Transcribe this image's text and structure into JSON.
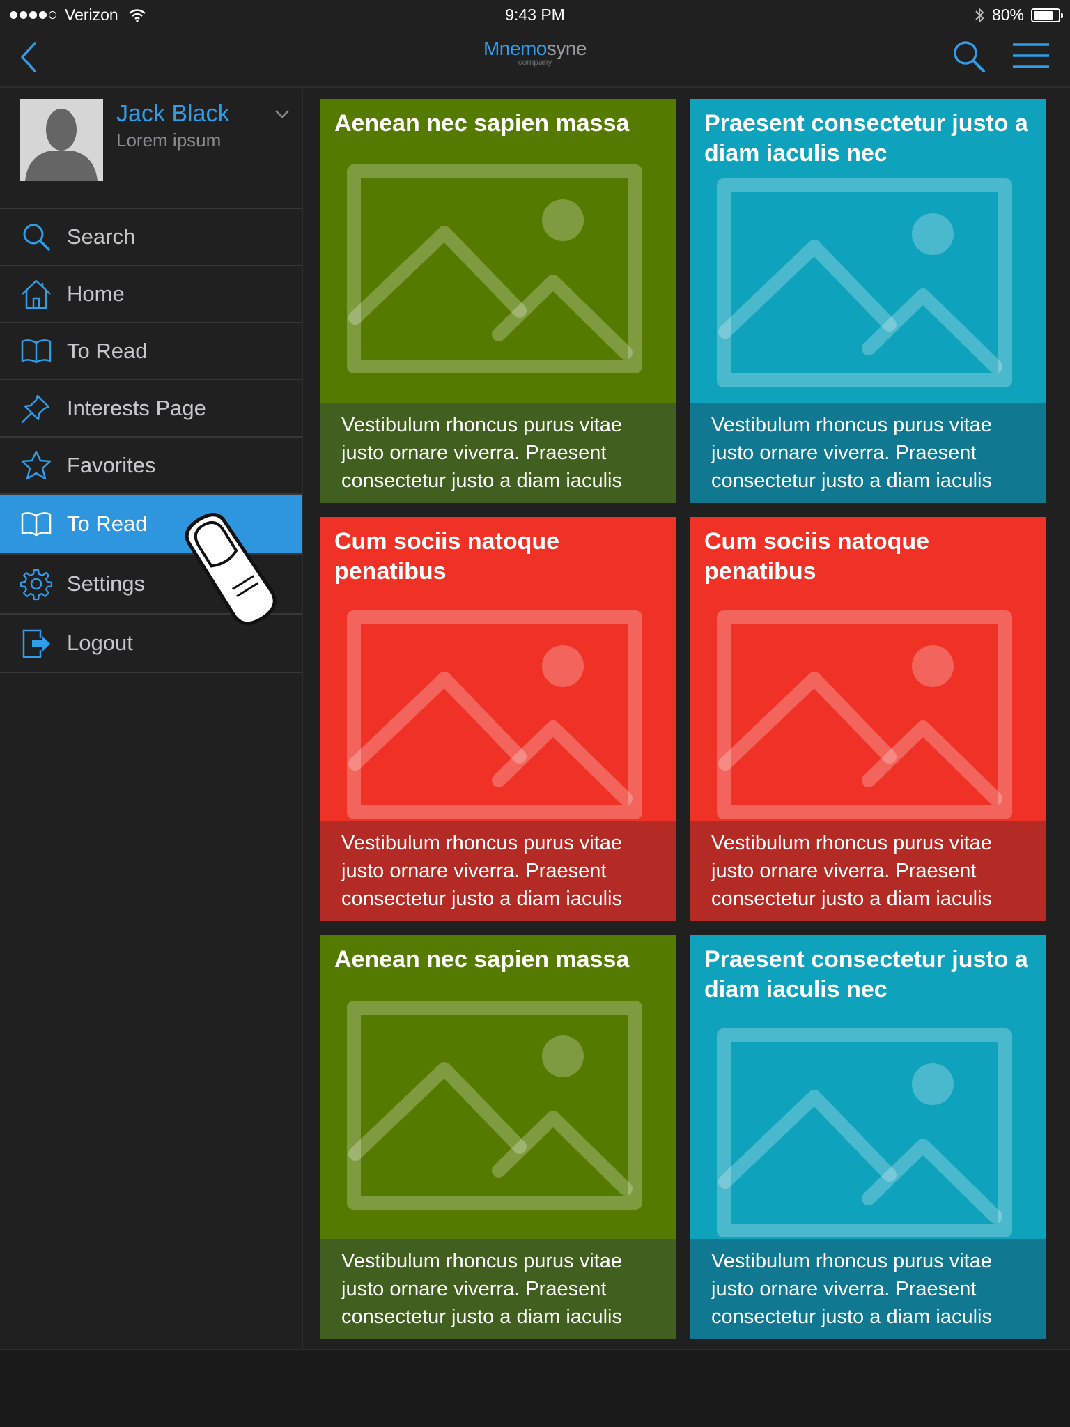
{
  "status_bar": {
    "carrier": "Verizon",
    "time": "9:43 PM",
    "battery": "80%",
    "battery_level": 0.8
  },
  "navbar": {
    "logo_part1": "Mnemo",
    "logo_part2": "syne",
    "logo_tagline": "company"
  },
  "profile": {
    "name": "Jack Black",
    "subtitle": "Lorem ipsum"
  },
  "menu": [
    {
      "label": "Search",
      "icon": "search-icon"
    },
    {
      "label": "Home",
      "icon": "home-icon"
    },
    {
      "label": "To Read",
      "icon": "book-icon"
    },
    {
      "label": "Interests Page",
      "icon": "pin-icon"
    },
    {
      "label": "Favorites",
      "icon": "star-icon"
    },
    {
      "label": "To Read",
      "icon": "book-icon",
      "active": true
    },
    {
      "label": "Settings",
      "icon": "gear-icon"
    },
    {
      "label": "Logout",
      "icon": "logout-icon"
    }
  ],
  "cards": [
    {
      "title": "Aenean nec sapien massa",
      "body": "Vestibulum rhoncus purus vitae justo ornare viverra. Praesent consectetur justo a diam iaculis",
      "color": "green"
    },
    {
      "title": "Praesent consectetur justo a diam iaculis nec",
      "body": "Vestibulum rhoncus purus vitae justo ornare viverra. Praesent consectetur justo a diam iaculis",
      "color": "blue"
    },
    {
      "title": "Cum sociis natoque penatibus",
      "body": "Vestibulum rhoncus purus vitae justo ornare viverra. Praesent consectetur justo a diam iaculis",
      "color": "red"
    },
    {
      "title": "Cum sociis natoque penatibus",
      "body": "Vestibulum rhoncus purus vitae justo ornare viverra. Praesent consectetur justo a diam iaculis",
      "color": "red"
    },
    {
      "title": "Aenean nec sapien massa",
      "body": "Vestibulum rhoncus purus vitae justo ornare viverra. Praesent consectetur justo a diam iaculis",
      "color": "green"
    },
    {
      "title": "Praesent consectetur justo a diam iaculis nec",
      "body": "Vestibulum rhoncus purus vitae justo ornare viverra. Praesent consectetur justo a diam iaculis",
      "color": "blue"
    }
  ],
  "colors": {
    "accent": "#2e96de",
    "green": "#547a00",
    "blue": "#0fa2bd",
    "red": "#ef3126",
    "background": "#202021"
  }
}
